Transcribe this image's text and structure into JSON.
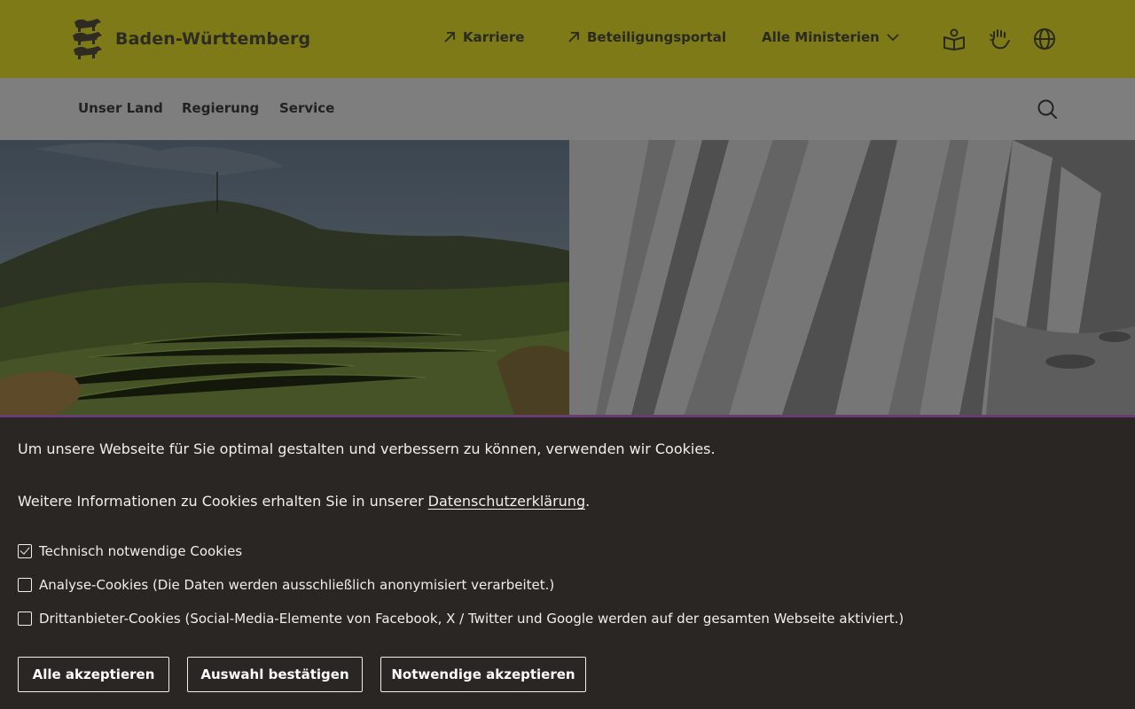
{
  "header": {
    "brand_name": "Baden-Württemberg",
    "links": [
      {
        "label": "Karriere"
      },
      {
        "label": "Beteiligungsportal"
      },
      {
        "label": "Alle Ministerien"
      }
    ],
    "icons": [
      "easy-language-icon",
      "sign-language-icon",
      "globe-icon"
    ]
  },
  "nav": {
    "items": [
      {
        "label": "Unser Land"
      },
      {
        "label": "Regierung"
      },
      {
        "label": "Service"
      }
    ],
    "search_icon": "search-icon"
  },
  "cookie_banner": {
    "intro": "Um unsere Webseite für Sie optimal gestalten und verbessern zu können, verwenden wir Cookies.",
    "info_prefix": "Weitere Informationen zu Cookies erhalten Sie in unserer",
    "info_link": "Datenschutzerklärung",
    "info_suffix": ".",
    "options": [
      {
        "label": "Technisch notwendige Cookies",
        "checked": true
      },
      {
        "label": "Analyse-Cookies (Die Daten werden ausschließlich anonymisiert verarbeitet.)",
        "checked": false
      },
      {
        "label": "Drittanbieter-Cookies (Social-Media-Elemente von Facebook, X / Twitter und Google werden auf der gesamten Webseite aktiviert.)",
        "checked": false
      }
    ],
    "buttons": {
      "accept_all": "Alle akzeptieren",
      "confirm_selection": "Auswahl bestätigen",
      "accept_necessary": "Notwendige akzeptieren"
    }
  },
  "colors": {
    "header_bg": "#7d7a17",
    "nav_bg": "#7e7e7e",
    "cookie_bg": "#292623",
    "accent_line": "#6a3c73"
  }
}
